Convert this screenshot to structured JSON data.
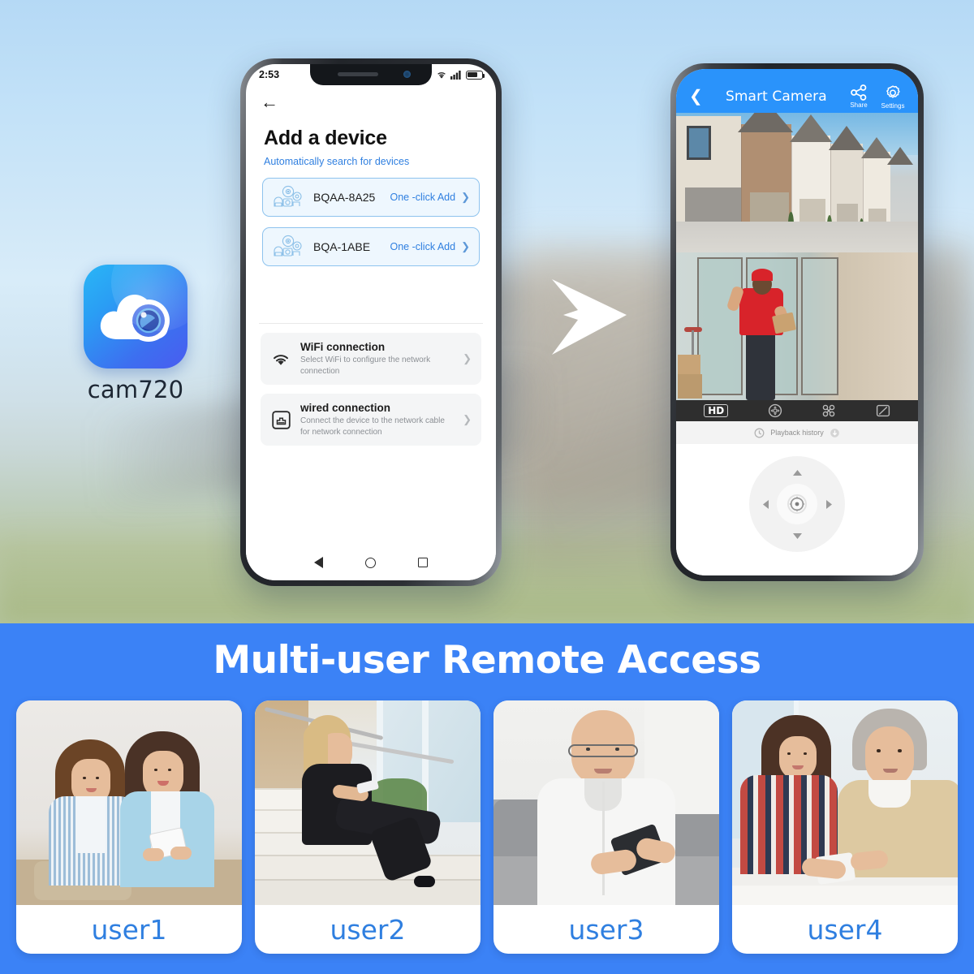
{
  "app": {
    "logo_caption": "cam720",
    "logo_icon": "cloud-camera-icon"
  },
  "phone_left": {
    "status_bar": {
      "time": "2:53",
      "wifi_icon": "wifi-icon",
      "signal_icon": "signal-bars-icon",
      "battery_icon": "battery-icon"
    },
    "back_icon": "back-arrow-icon",
    "title": "Add a device",
    "subtitle": "Automatically search for devices",
    "devices": [
      {
        "name": "BQAA-8A25",
        "action": "One -click Add",
        "icon": "camera-devices-icon",
        "chevron": "chevron-right-icon"
      },
      {
        "name": "BQA-1ABE",
        "action": "One -click Add",
        "icon": "camera-devices-icon",
        "chevron": "chevron-right-icon"
      }
    ],
    "connections": [
      {
        "title": "WiFi connection",
        "description": "Select WiFi to configure the network connection",
        "icon": "wifi-icon",
        "chevron": "chevron-right-icon"
      },
      {
        "title": "wired connection",
        "description": "Connect the device to the network cable for network connection",
        "icon": "ethernet-port-icon",
        "chevron": "chevron-right-icon"
      }
    ],
    "nav_bar": {
      "back": "back-triangle-icon",
      "home": "home-circle-icon",
      "recents": "recents-square-icon"
    }
  },
  "phone_right": {
    "header": {
      "back_icon": "back-chevron-icon",
      "title": "Smart Camera",
      "share_label": "Share",
      "share_icon": "share-nodes-icon",
      "settings_label": "Settings",
      "settings_icon": "gear-icon"
    },
    "feeds": [
      {
        "name": "townhouse-street-feed",
        "description": "Row of townhouses along a driveway"
      },
      {
        "name": "front-door-delivery-feed",
        "description": "Delivery person in red shirt and cap at glass door holding a package"
      }
    ],
    "control_bar": {
      "quality_badge": "HD",
      "buttons": [
        {
          "icon": "pan-tilt-icon"
        },
        {
          "icon": "motion-detect-icon"
        },
        {
          "icon": "fullscreen-icon"
        }
      ]
    },
    "playback": {
      "label": "Playback history",
      "left_icon": "history-clock-icon",
      "right_icon": "download-icon"
    },
    "dpad": {
      "up_icon": "arrow-up-icon",
      "down_icon": "arrow-down-icon",
      "left_icon": "arrow-left-icon",
      "right_icon": "arrow-right-icon",
      "center_icon": "target-center-icon"
    }
  },
  "flow_arrow_icon": "arrow-right-flow-icon",
  "banner": {
    "title": "Multi-user Remote Access",
    "background_color": "#3b82f6",
    "accent_color": "#2f7fe0",
    "cards": [
      {
        "label": "user1",
        "photo": "two-young-women-with-phone-on-couch"
      },
      {
        "label": "user2",
        "photo": "businesswoman-on-steps-with-phone"
      },
      {
        "label": "user3",
        "photo": "older-man-with-glasses-holding-phone"
      },
      {
        "label": "user4",
        "photo": "young-woman-and-older-man-with-phone"
      }
    ]
  }
}
